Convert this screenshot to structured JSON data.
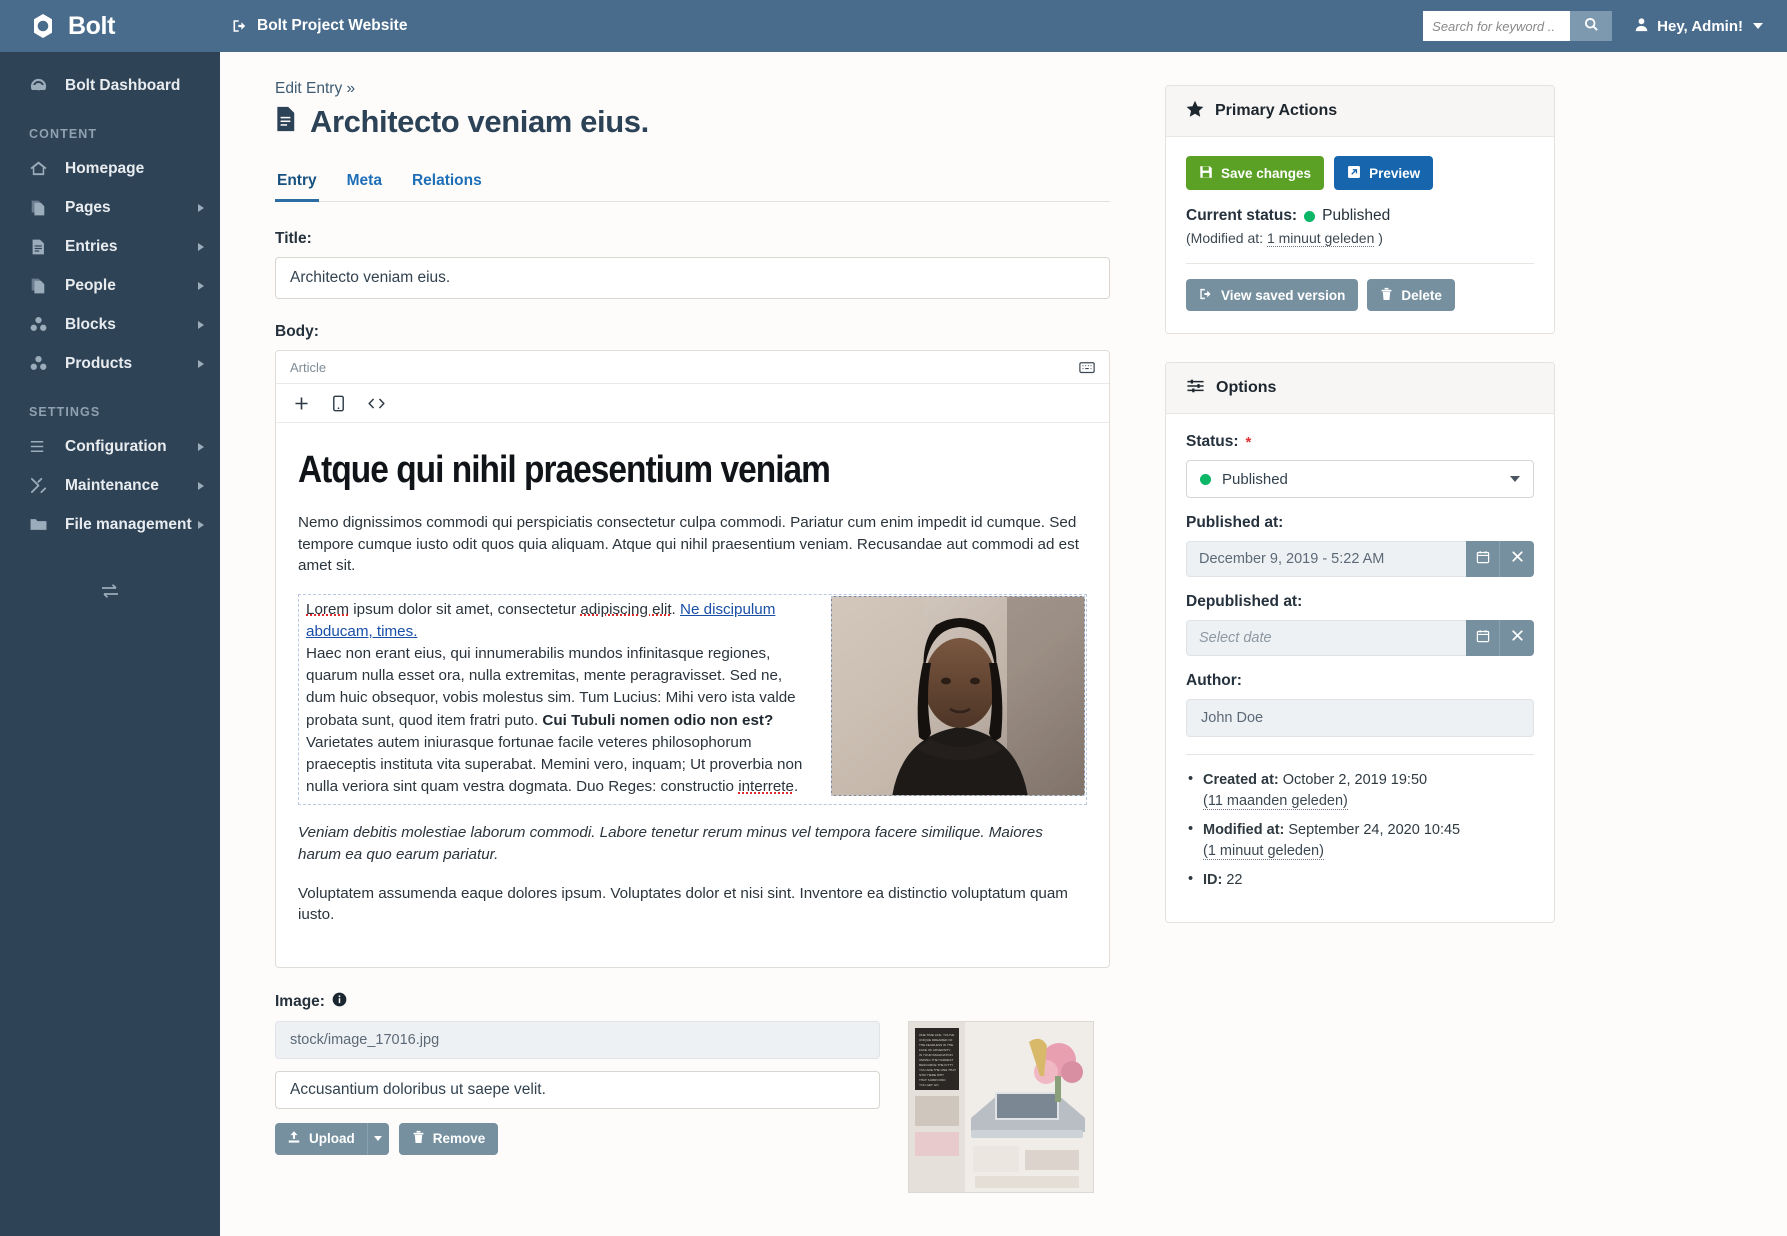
{
  "topbar": {
    "brand": "Bolt",
    "project_link": "Bolt Project Website",
    "search_placeholder": "Search for keyword ..",
    "search_value": "",
    "user_label": "Hey, Admin!"
  },
  "sidebar": {
    "dashboard": "Bolt Dashboard",
    "sections": [
      {
        "title": "CONTENT",
        "items": [
          {
            "label": "Homepage",
            "icon": "home-icon",
            "arrow": false
          },
          {
            "label": "Pages",
            "icon": "pages-icon",
            "arrow": true
          },
          {
            "label": "Entries",
            "icon": "entries-icon",
            "arrow": true
          },
          {
            "label": "People",
            "icon": "people-icon",
            "arrow": true
          },
          {
            "label": "Blocks",
            "icon": "blocks-icon",
            "arrow": true
          },
          {
            "label": "Products",
            "icon": "products-icon",
            "arrow": true
          }
        ]
      },
      {
        "title": "SETTINGS",
        "items": [
          {
            "label": "Configuration",
            "icon": "sliders-icon",
            "arrow": true
          },
          {
            "label": "Maintenance",
            "icon": "tools-icon",
            "arrow": true
          },
          {
            "label": "File management",
            "icon": "folder-icon",
            "arrow": true
          }
        ]
      }
    ]
  },
  "page": {
    "breadcrumb": "Edit Entry »",
    "title": "Architecto veniam eius.",
    "tabs": [
      {
        "label": "Entry",
        "active": true
      },
      {
        "label": "Meta",
        "active": false
      },
      {
        "label": "Relations",
        "active": false
      }
    ]
  },
  "form": {
    "title_label": "Title:",
    "title_value": "Architecto veniam eius.",
    "body_label": "Body:",
    "image_label": "Image:"
  },
  "editor": {
    "tab_label": "Article",
    "heading": "Atque qui nihil praesentium veniam",
    "paragraph1": "Nemo dignissimos commodi qui perspiciatis consectetur culpa commodi. Pariatur cum enim impedit id cumque. Sed tempore cumque iusto odit quos quia aliquam. Atque qui nihil praesentium veniam. Recusandae aut commodi ad est amet sit.",
    "block_text_1": "Lorem",
    "block_text_2": " ipsum dolor sit amet, consectetur ",
    "block_text_3": "adipiscing elit",
    "block_text_4": ". ",
    "block_link": "Ne discipulum abducam, times.",
    "block_text_5": "Haec non erant eius, qui innumerabilis mundos infinitasque regiones, quarum nulla esset ora, nulla extremitas, mente peragravisset. Sed ne, dum huic obsequor, vobis molestus sim. Tum Lucius: Mihi vero ista valde probata sunt, quod item fratri puto. ",
    "block_bold": "Cui Tubuli nomen odio non est?",
    "block_text_6": " Varietates autem iniurasque fortunae facile veteres philosophorum praeceptis instituta vita superabat. Memini vero, inquam; Ut proverbia non nulla veriora sint quam vestra dogmata. Duo Reges: constructio ",
    "block_text_7": "interrete",
    "block_text_8": ".",
    "paragraph_italic": "Veniam debitis molestiae laborum commodi. Labore tenetur rerum minus vel tempora facere similique. Maiores harum ea quo earum pariatur.",
    "paragraph_last": "Voluptatem assumenda eaque dolores ipsum. Voluptates dolor et nisi sint. Inventore ea distinctio voluptatum quam iusto."
  },
  "image_field": {
    "filename": "stock/image_17016.jpg",
    "alt_text": "Accusantium doloribus ut saepe velit.",
    "upload_label": "Upload",
    "remove_label": "Remove"
  },
  "primary_actions": {
    "title": "Primary Actions",
    "save_label": "Save changes",
    "preview_label": "Preview",
    "current_status_label": "Current status:",
    "current_status_value": "Published",
    "modified_prefix": "(Modified at: ",
    "modified_value": "1 minuut geleden",
    "modified_suffix": " )",
    "view_saved_label": "View saved version",
    "delete_label": "Delete"
  },
  "options": {
    "title": "Options",
    "status_label": "Status:",
    "status_value": "Published",
    "published_label": "Published at:",
    "published_value": "December 9, 2019 - 5:22 AM",
    "depublished_label": "Depublished at:",
    "depublished_placeholder": "Select date",
    "author_label": "Author:",
    "author_value": "John Doe",
    "meta": [
      {
        "key": "Created at:",
        "value": " October 2, 2019 19:50",
        "sub": "(11 maanden geleden)"
      },
      {
        "key": "Modified at:",
        "value": " September 24, 2020 10:45",
        "sub": "(1 minuut geleden)"
      },
      {
        "key": "ID:",
        "value": " 22",
        "sub": ""
      }
    ]
  },
  "colors": {
    "topbar": "#4a6c8c",
    "sidebar": "#2f4356",
    "green": "#5aa126",
    "blue": "#1766ad",
    "gray": "#76909f",
    "status_dot": "#0bb667",
    "required": "#e03030"
  }
}
